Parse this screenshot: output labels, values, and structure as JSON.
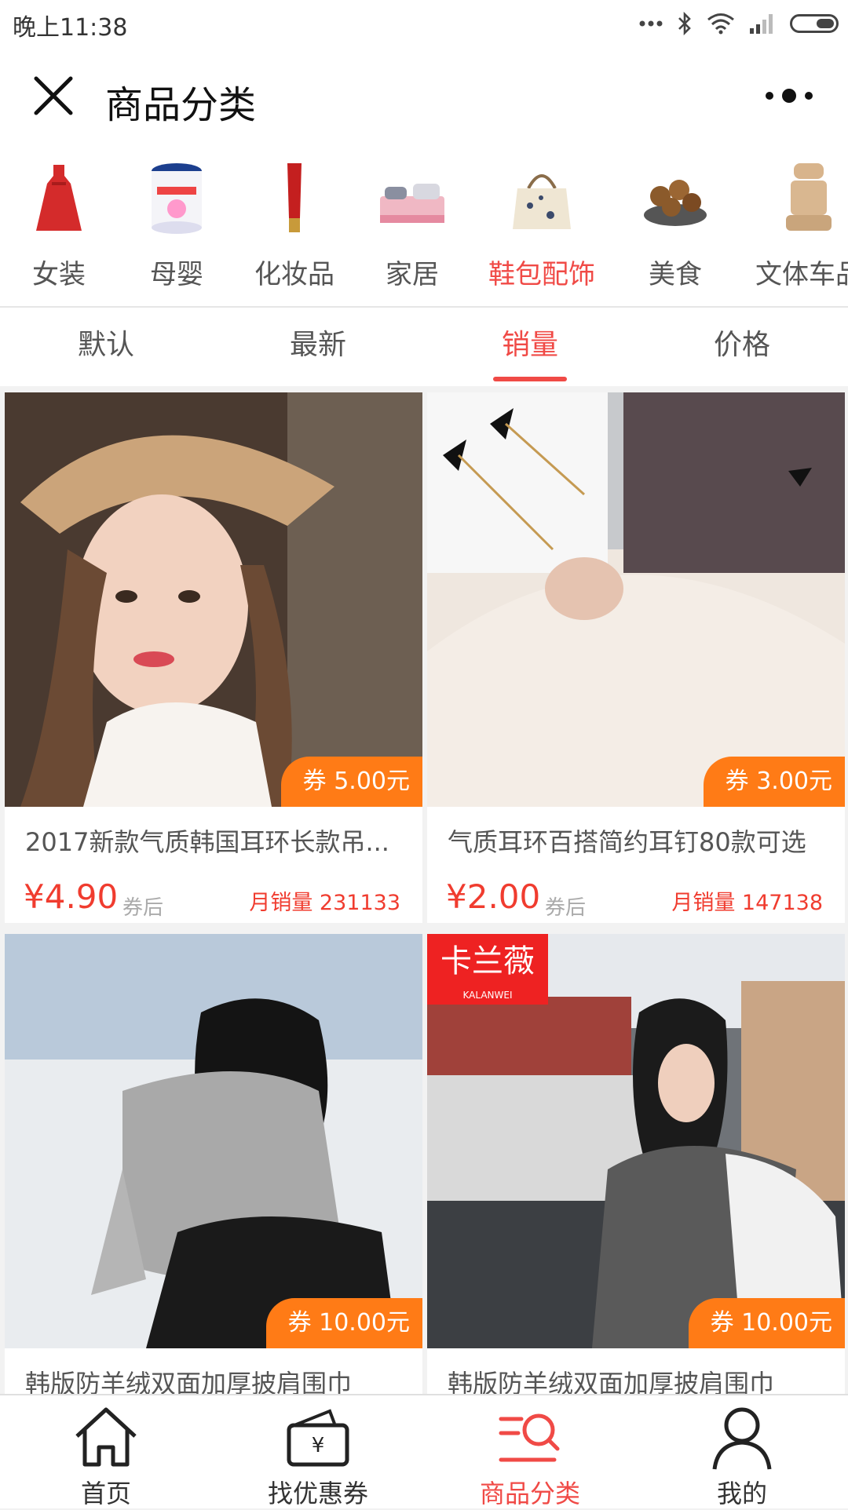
{
  "status_bar": {
    "time": "晚上11:38"
  },
  "header": {
    "title": "商品分类"
  },
  "categories": [
    {
      "label": "女装",
      "icon": "dress-icon"
    },
    {
      "label": "母婴",
      "icon": "milk-powder-icon"
    },
    {
      "label": "化妆品",
      "icon": "cosmetics-tube-icon"
    },
    {
      "label": "家居",
      "icon": "bedding-icon"
    },
    {
      "label": "鞋包配饰",
      "icon": "handbag-icon",
      "active": true
    },
    {
      "label": "美食",
      "icon": "food-bowl-icon"
    },
    {
      "label": "文体车品",
      "icon": "car-seat-icon"
    }
  ],
  "sort_tabs": [
    {
      "label": "默认"
    },
    {
      "label": "最新"
    },
    {
      "label": "销量",
      "active": true
    },
    {
      "label": "价格"
    }
  ],
  "products": [
    {
      "name": "2017新款气质韩国耳环长款吊...",
      "coupon": "券 5.00元",
      "price": "¥4.90",
      "after": "券后",
      "sales": "月销量 231133"
    },
    {
      "name": "气质耳环百搭简约耳钉80款可选",
      "coupon": "券 3.00元",
      "price": "¥2.00",
      "after": "券后",
      "sales": "月销量 147138"
    },
    {
      "name": "韩版防羊绒双面加厚披肩围巾",
      "coupon": "券 10.00元"
    },
    {
      "name": "韩版防羊绒双面加厚披肩围巾",
      "coupon": "券 10.00元",
      "brand": "卡兰薇",
      "brand_sub": "KALANWEI"
    }
  ],
  "tabbar": [
    {
      "label": "首页",
      "icon": "home-icon"
    },
    {
      "label": "找优惠券",
      "icon": "coupon-icon"
    },
    {
      "label": "商品分类",
      "icon": "category-search-icon",
      "active": true
    },
    {
      "label": "我的",
      "icon": "user-icon"
    }
  ],
  "colors": {
    "accent": "#f04a46",
    "coupon": "#ff7b16",
    "price": "#f03c2f"
  }
}
